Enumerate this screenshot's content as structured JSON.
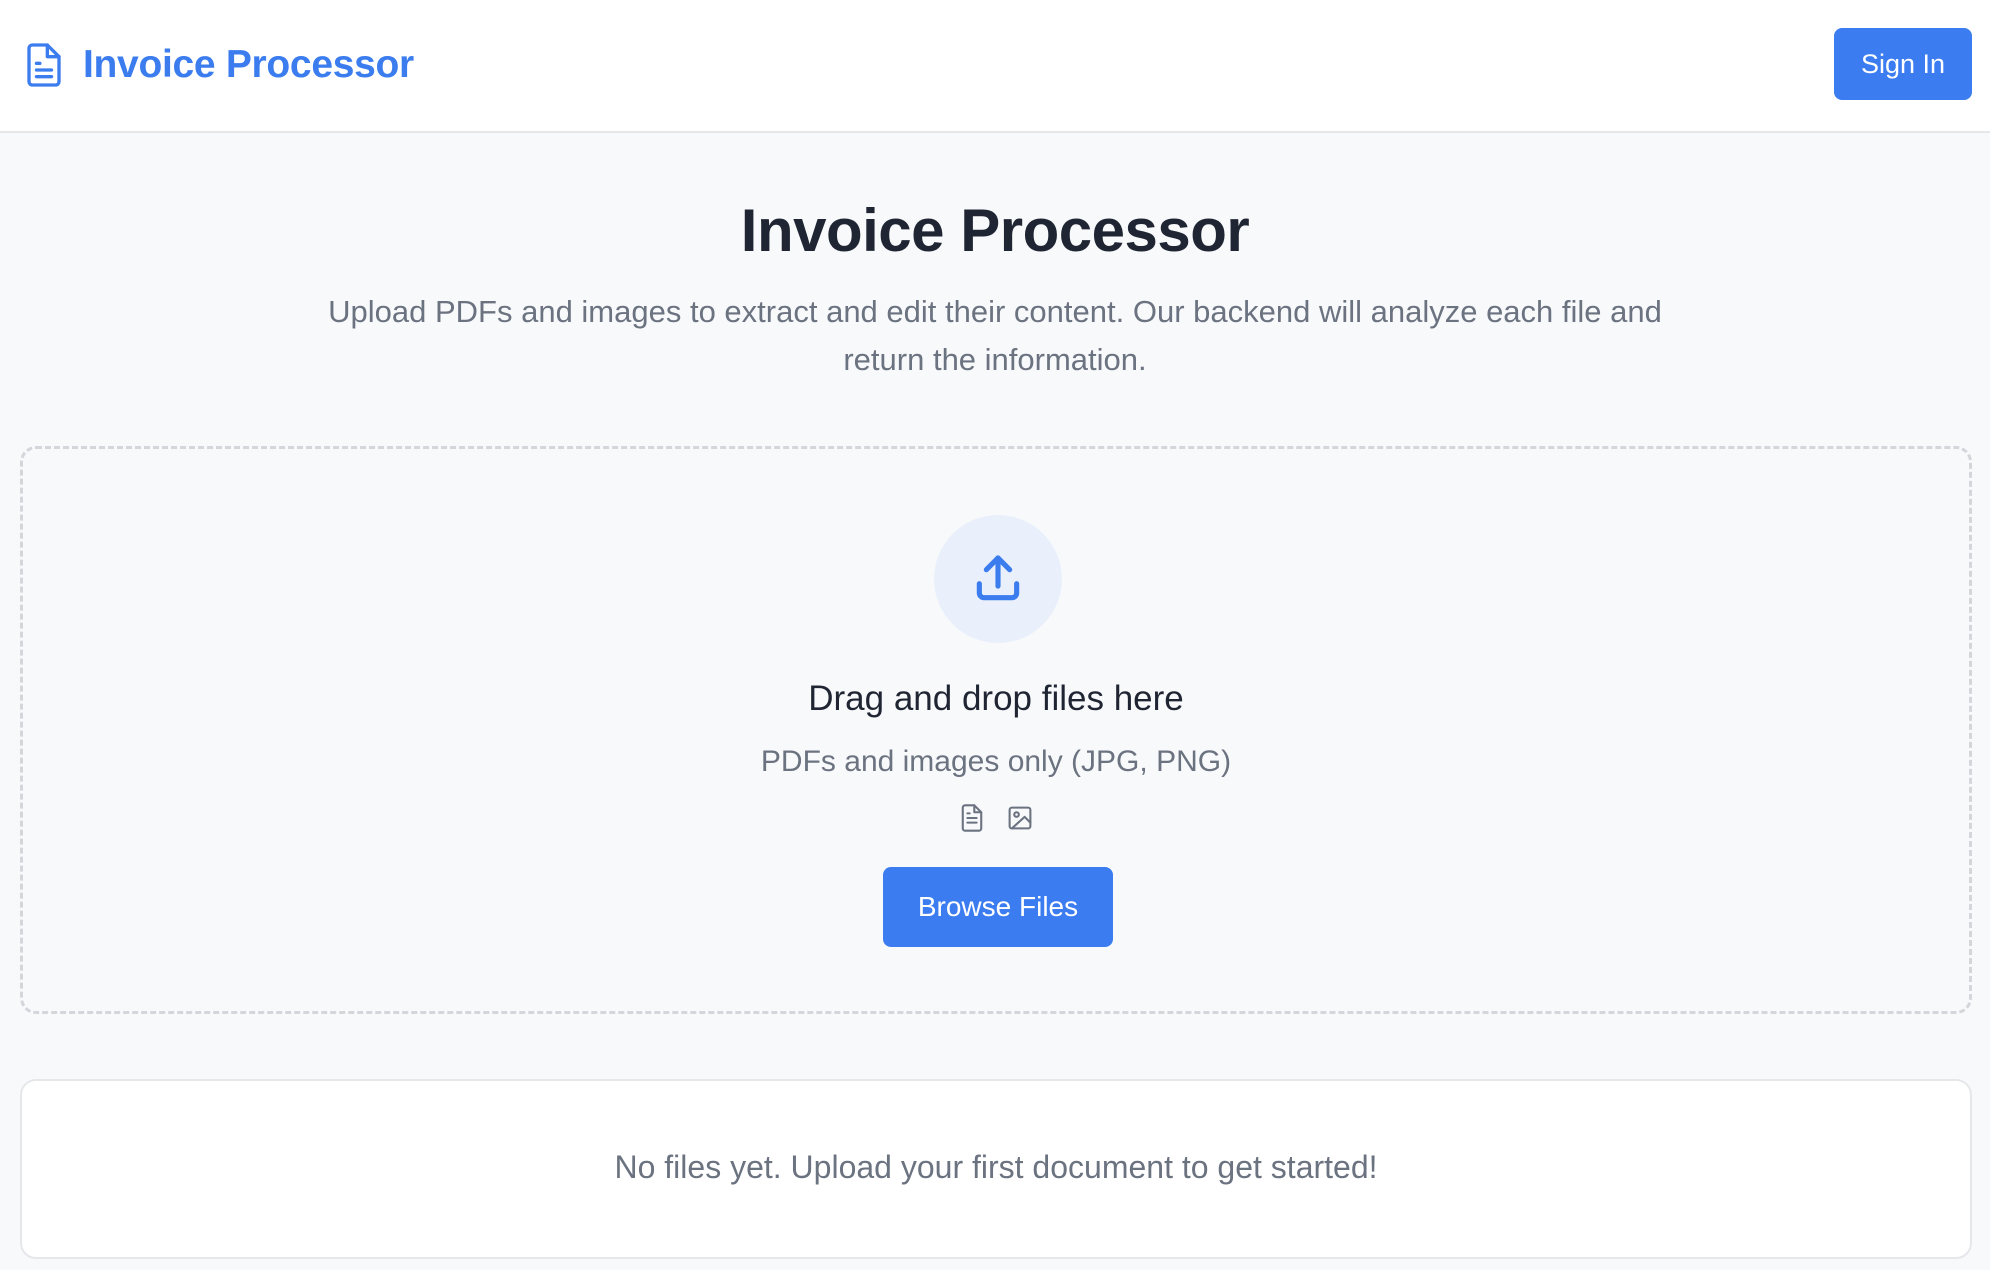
{
  "header": {
    "brand_icon": "document-icon",
    "brand_title": "Invoice Processor",
    "signin_label": "Sign In"
  },
  "hero": {
    "title": "Invoice Processor",
    "subtitle": "Upload PDFs and images to extract and edit their content. Our backend will analyze each file and return the information."
  },
  "dropzone": {
    "icon": "upload-icon",
    "title": "Drag and drop files here",
    "hint": "PDFs and images only (JPG, PNG)",
    "file_type_icons": [
      "pdf-file-icon",
      "image-file-icon"
    ],
    "browse_label": "Browse Files"
  },
  "files": {
    "empty_message": "No files yet. Upload your first document to get started!"
  },
  "colors": {
    "accent": "#3b7cf0",
    "text_dark": "#1f2533",
    "text_muted": "#6b7280",
    "page_bg": "#f8f9fb"
  }
}
